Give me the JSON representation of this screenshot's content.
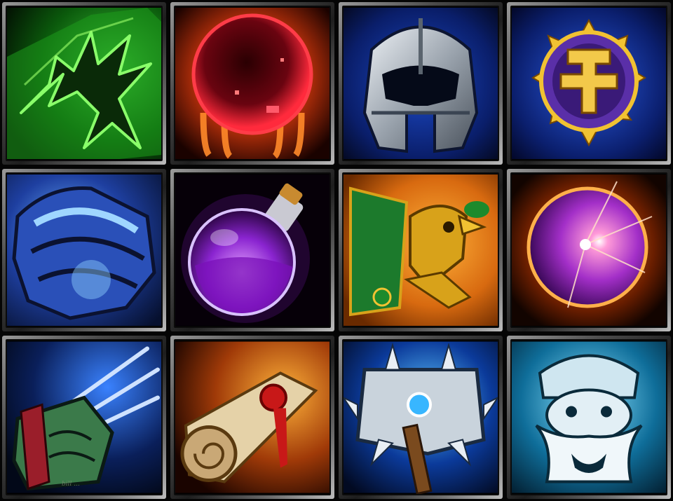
{
  "icons": [
    {
      "name": "green-winged-boot-icon",
      "colors": {
        "bg": "#062006",
        "main": "#2fd62a",
        "glow": "#9dff6b"
      }
    },
    {
      "name": "blood-orb-icon",
      "colors": {
        "bg": "#2a0400",
        "main": "#c40c22",
        "glow": "#ff7a1a"
      }
    },
    {
      "name": "steel-helmet-icon",
      "colors": {
        "bg": "#071b5e",
        "main": "#b9c1c9",
        "glow": "#3f7bff"
      }
    },
    {
      "name": "golden-sun-amulet-icon",
      "colors": {
        "bg": "#0b1f6e",
        "main": "#f1c232",
        "glow": "#6a3fb8"
      }
    },
    {
      "name": "blue-armored-gauntlet-icon",
      "colors": {
        "bg": "#0b1a44",
        "main": "#2f64d6",
        "glow": "#8fd0ff"
      }
    },
    {
      "name": "purple-potion-flask-icon",
      "colors": {
        "bg": "#0a0010",
        "main": "#9b2fe0",
        "glow": "#d68cff"
      }
    },
    {
      "name": "golden-hawk-idol-icon",
      "colors": {
        "bg": "#d86a10",
        "main": "#d8a21a",
        "glow": "#1c8a2c"
      }
    },
    {
      "name": "arcane-orb-icon",
      "colors": {
        "bg": "#1a0800",
        "main": "#a32fc8",
        "glow": "#ff8c2a"
      }
    },
    {
      "name": "clawed-fist-icon",
      "colors": {
        "bg": "#0a1f5a",
        "main": "#3b7a4a",
        "glow": "#9fc8ff"
      }
    },
    {
      "name": "sealed-scroll-icon",
      "colors": {
        "bg": "#5a1a00",
        "main": "#e5d2a8",
        "glow": "#c81818"
      }
    },
    {
      "name": "frost-spiked-mace-icon",
      "colors": {
        "bg": "#06205a",
        "main": "#c9d3dc",
        "glow": "#38b6ff"
      }
    },
    {
      "name": "frost-bearded-dwarf-icon",
      "colors": {
        "bg": "#0a3d5e",
        "main": "#cfe6f0",
        "glow": "#5fd0ff"
      }
    }
  ],
  "signature": "bill ..."
}
